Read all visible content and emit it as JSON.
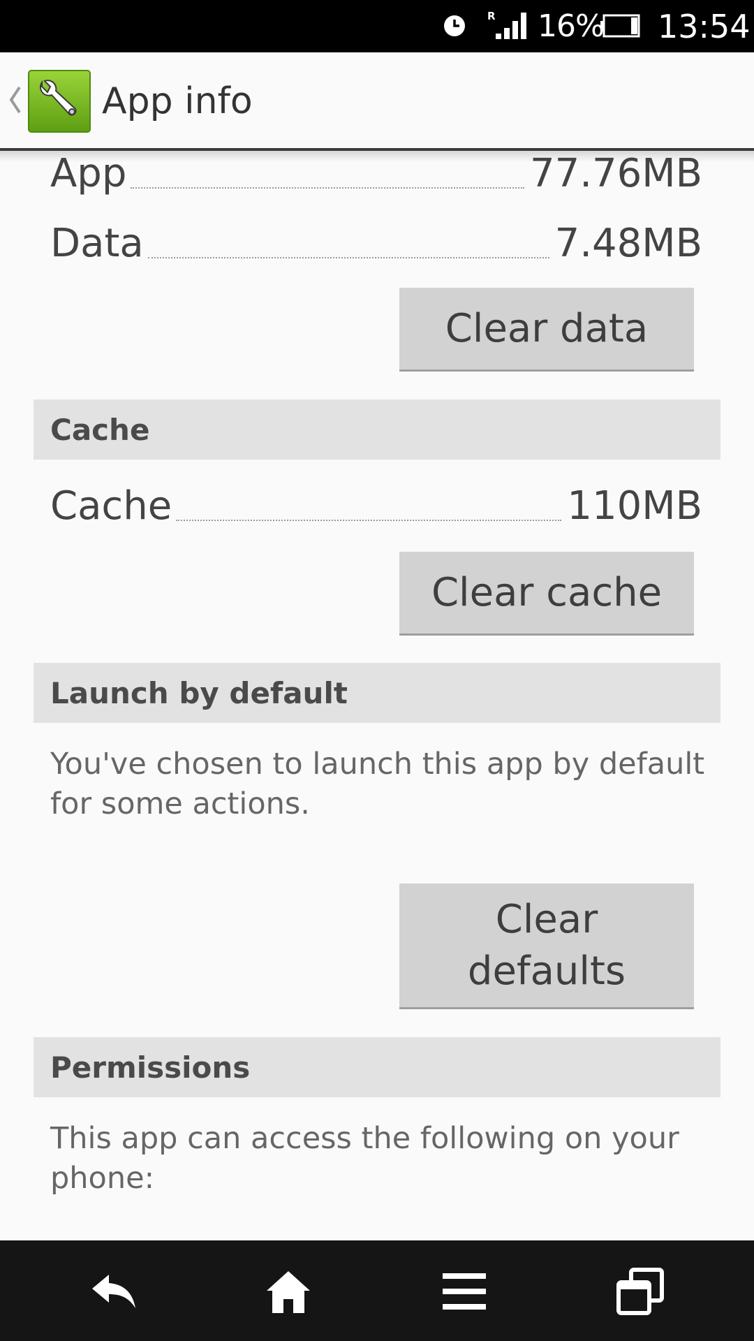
{
  "status_bar": {
    "battery_percent": "16%",
    "time": "13:54",
    "roaming_indicator": "R",
    "icons": [
      "alarm-icon",
      "signal-icon",
      "battery-icon"
    ]
  },
  "action_bar": {
    "title": "App info",
    "icons": [
      "up-chevron-icon",
      "settings-wrench-icon"
    ]
  },
  "storage": {
    "app_label": "App",
    "app_value": "77.76MB",
    "data_label": "Data",
    "data_value": "7.48MB",
    "clear_data_label": "Clear data"
  },
  "cache": {
    "header": "Cache",
    "label": "Cache",
    "value": "110MB",
    "clear_cache_label": "Clear cache"
  },
  "launch_default": {
    "header": "Launch by default",
    "description": "You've chosen to launch this app by default for some actions.",
    "clear_defaults_label": "Clear defaults"
  },
  "permissions": {
    "header": "Permissions",
    "description": "This app can access the following on your phone:"
  },
  "nav_bar": {
    "icons": [
      "back-icon",
      "home-icon",
      "menu-icon",
      "recent-apps-icon"
    ]
  },
  "colors": {
    "status_bar": "#000000",
    "background": "#fafafa",
    "section_header": "#e2e2e2",
    "button": "#d2d2d2",
    "nav_bar": "#151515",
    "app_icon_green": "#7cbf1f"
  }
}
